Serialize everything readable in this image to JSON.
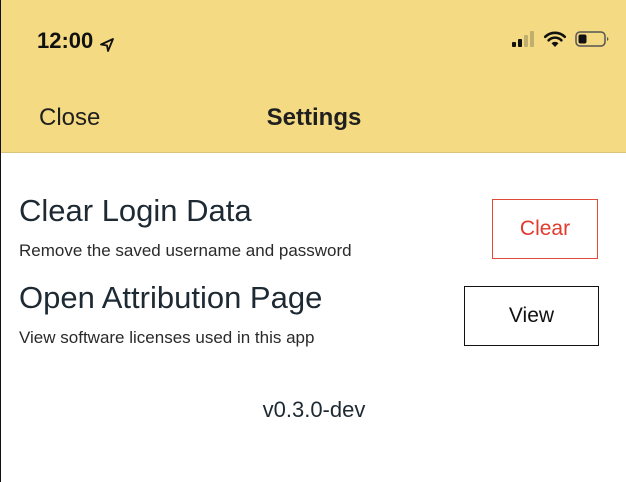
{
  "status_bar": {
    "time": "12:00",
    "icons": [
      "location-arrow-icon",
      "signal-icon",
      "wifi-icon",
      "battery-icon"
    ]
  },
  "nav": {
    "close_label": "Close",
    "title": "Settings"
  },
  "settings": [
    {
      "title": "Clear Login Data",
      "description": "Remove the saved username and password",
      "button_label": "Clear"
    },
    {
      "title": "Open Attribution Page",
      "description": "View software licenses used in this app",
      "button_label": "View"
    }
  ],
  "version": "v0.3.0-dev",
  "colors": {
    "header_bg": "#f4da82",
    "clear_accent": "#e03b2d",
    "text_primary": "#1e2a33"
  }
}
